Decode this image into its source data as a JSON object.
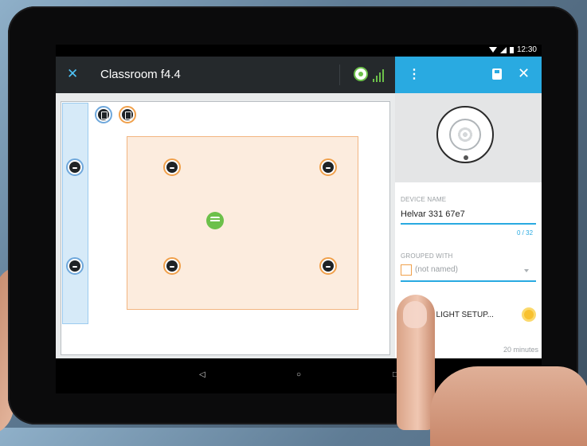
{
  "status_bar": {
    "time": "12:30"
  },
  "app": {
    "close_icon": "close-icon",
    "title": "Classroom f4.4",
    "network_icon": "network-status-icon",
    "signal_icon": "signal-bars-icon"
  },
  "colors": {
    "toolbar": "#25292c",
    "accent": "#29aae1",
    "group_orange": "#f0a04b",
    "group_blue": "#6fa8dc",
    "sensor_green": "#6cc04a"
  },
  "side_panel": {
    "menu_icon": "more-vert-icon",
    "save_icon": "save-icon",
    "close_icon": "close-icon",
    "device_name_label": "DEVICE NAME",
    "device_name_value": "Helvar 331 67e7",
    "device_name_counter": "0 / 32",
    "grouped_with_label": "GROUPED WITH",
    "grouped_with_value": "(not named)",
    "light_setup_label": "IT LIGHT SETUP...",
    "delay_value": "20 minutes"
  },
  "nav_bar": {
    "back": "◁",
    "home": "○",
    "recents": "□"
  }
}
